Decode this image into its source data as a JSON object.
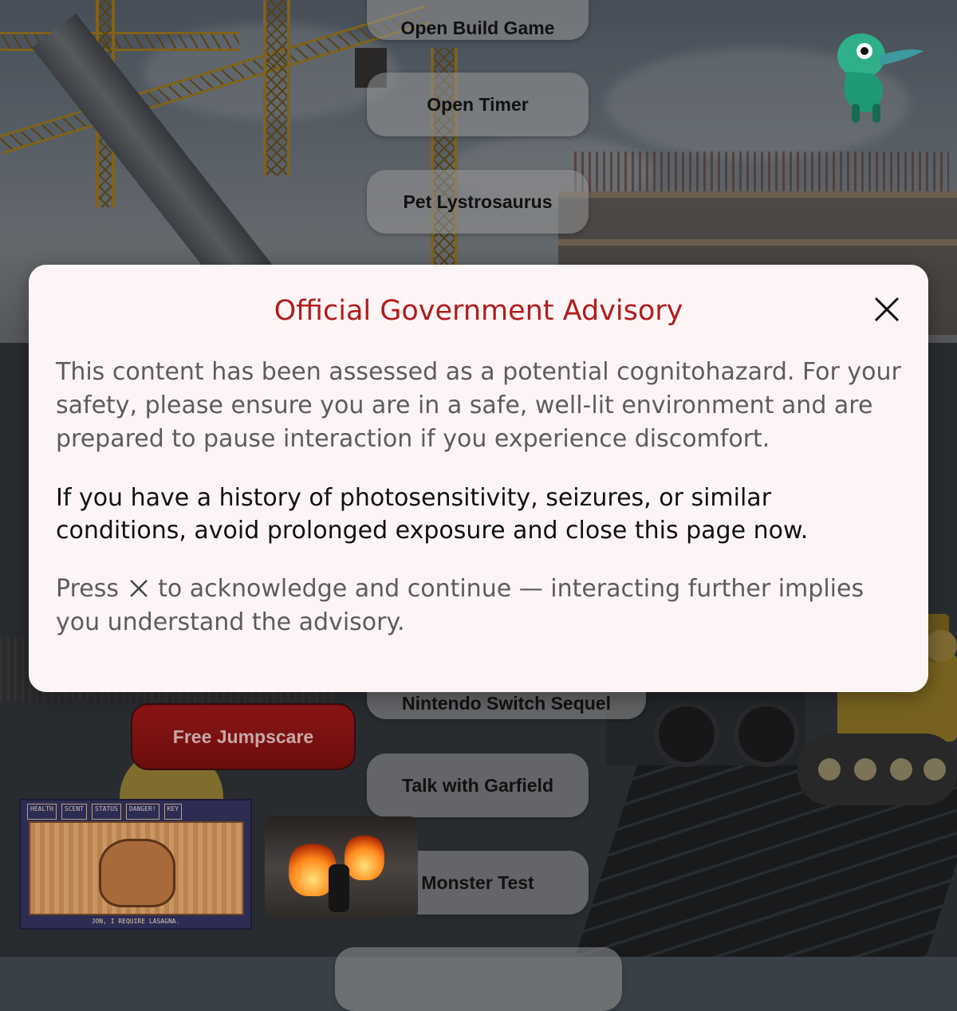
{
  "menu": {
    "buttons": [
      {
        "label": "Open Build Game"
      },
      {
        "label": "Open Timer"
      },
      {
        "label": "Pet Lystrosaurus"
      },
      {
        "label": "Nintendo Switch Sequel"
      },
      {
        "label": "Talk with Garfield"
      },
      {
        "label": "Monster Test"
      }
    ],
    "jumpscare_label": "Free Jumpscare"
  },
  "thumbnails": {
    "garfield": {
      "hud_health": "HEALTH",
      "hud_scent": "SCENT",
      "hud_status": "STATUS",
      "hud_danger": "DANGER!",
      "hud_key": "KEY",
      "caption": "JON, I REQUIRE LASAGNA.",
      "icon": "pixel-art-game-thumbnail"
    },
    "motorcycle": {
      "icon": "flaming-motorcycle-thumbnail"
    }
  },
  "modal": {
    "title": "Official Government Advisory",
    "paragraph1": "This content has been assessed as a potential cognitohazard. For your safety, please ensure you are in a safe, well-lit environment and are prepared to pause interaction if you experience discomfort.",
    "paragraph2": "If you have a history of photosensitivity, seizures, or similar conditions, avoid prolonged exposure and close this page now.",
    "paragraph3_before": "Press",
    "paragraph3_after": "to acknowledge and continue — interacting further implies you understand the advisory.",
    "close_icon": "close-icon"
  },
  "colors": {
    "title": "#b01c1c",
    "modal_bg": "#fdf5f5",
    "jumpscare": "#8c1414",
    "menu_button": "rgba(150,150,150,0.55)"
  }
}
